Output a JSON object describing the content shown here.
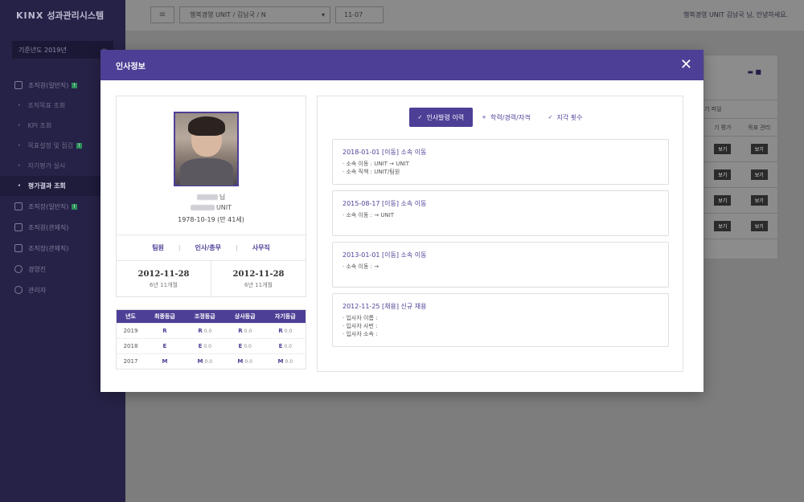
{
  "app": {
    "brand_bold": "KINX",
    "brand_rest": "성과관리시스템"
  },
  "sidebar": {
    "year_select": "기준년도 2019년",
    "year_clear": "×",
    "groups": [
      {
        "label": "조직원(일반직)",
        "badge": "!"
      }
    ],
    "sub_items": [
      {
        "label": "조직목표 조회",
        "badge": ""
      },
      {
        "label": "KPI 조회",
        "badge": ""
      },
      {
        "label": "목표설정 및 점검",
        "badge": "!"
      },
      {
        "label": "자기평가 실시",
        "badge": ""
      },
      {
        "label": "평가결과 조회",
        "badge": ""
      }
    ],
    "menu": [
      {
        "label": "조직장(일반직)",
        "badge": "!"
      },
      {
        "label": "조직원(관제직)",
        "badge": ""
      },
      {
        "label": "조직장(관제직)",
        "badge": ""
      },
      {
        "label": "경영진",
        "badge": ""
      },
      {
        "label": "관리자",
        "badge": ""
      }
    ]
  },
  "topbar": {
    "menu_icon": "≡",
    "org_select": "행복경영 UNIT  /  김남국  /  N",
    "org_arrow": "▾",
    "date_input": "11-07",
    "user_greeting": "행복경영 UNIT 김남국 님, 안녕하세요."
  },
  "background_panel": {
    "icons": "▬ ■",
    "header_1": "기 파일",
    "col_1": "기 평가",
    "col_2": "목표 관리",
    "button_label": "보기"
  },
  "modal": {
    "title": "인사정보",
    "close": "✕",
    "profile": {
      "name_suffix": "님",
      "unit": "UNIT",
      "birth": "1978-10-19 (만 41세)",
      "roles": [
        "팀원",
        "인사/총무",
        "사무직"
      ],
      "role_separator": "|",
      "dates": [
        {
          "date": "2012-11-28",
          "duration": "6년 11개월"
        },
        {
          "date": "2012-11-28",
          "duration": "6년 11개월"
        }
      ]
    },
    "grades": {
      "headers": [
        "년도",
        "최종등급",
        "조정등급",
        "상사등급",
        "자기등급"
      ],
      "rows": [
        {
          "year": "2019",
          "final": "R",
          "adjust": "R",
          "adjust_score": "0.0",
          "boss": "R",
          "boss_score": "0.0",
          "self": "R",
          "self_score": "0.0"
        },
        {
          "year": "2018",
          "final": "E",
          "adjust": "E",
          "adjust_score": "0.0",
          "boss": "E",
          "boss_score": "0.0",
          "self": "E",
          "self_score": "0.0"
        },
        {
          "year": "2017",
          "final": "M",
          "adjust": "M",
          "adjust_score": "0.0",
          "boss": "M",
          "boss_score": "0.0",
          "self": "M",
          "self_score": "0.0"
        }
      ]
    },
    "tabs": [
      {
        "label": "인사발령 이력",
        "mark": "✓"
      },
      {
        "label": "학력/경력/자격",
        "mark": "+"
      },
      {
        "label": "지각 횟수",
        "mark": "✓"
      }
    ],
    "history": [
      {
        "title": "2018-01-01 [이동] 소속 이동",
        "lines": [
          "소속 이동 :  UNIT →  UNIT",
          "소속 직책 :  UNIT/팀원"
        ]
      },
      {
        "title": "2015-08-17 [이동] 소속 이동",
        "lines": [
          "소속 이동 :  →  UNIT"
        ]
      },
      {
        "title": "2013-01-01 [이동] 소속 이동",
        "lines": [
          "소속 이동 :  → "
        ]
      },
      {
        "title": "2012-11-25 [채용] 신규 채용",
        "lines": [
          "입사자 이름 : ",
          "입사자 사번 : ",
          "입사자 소속 : "
        ]
      }
    ]
  }
}
